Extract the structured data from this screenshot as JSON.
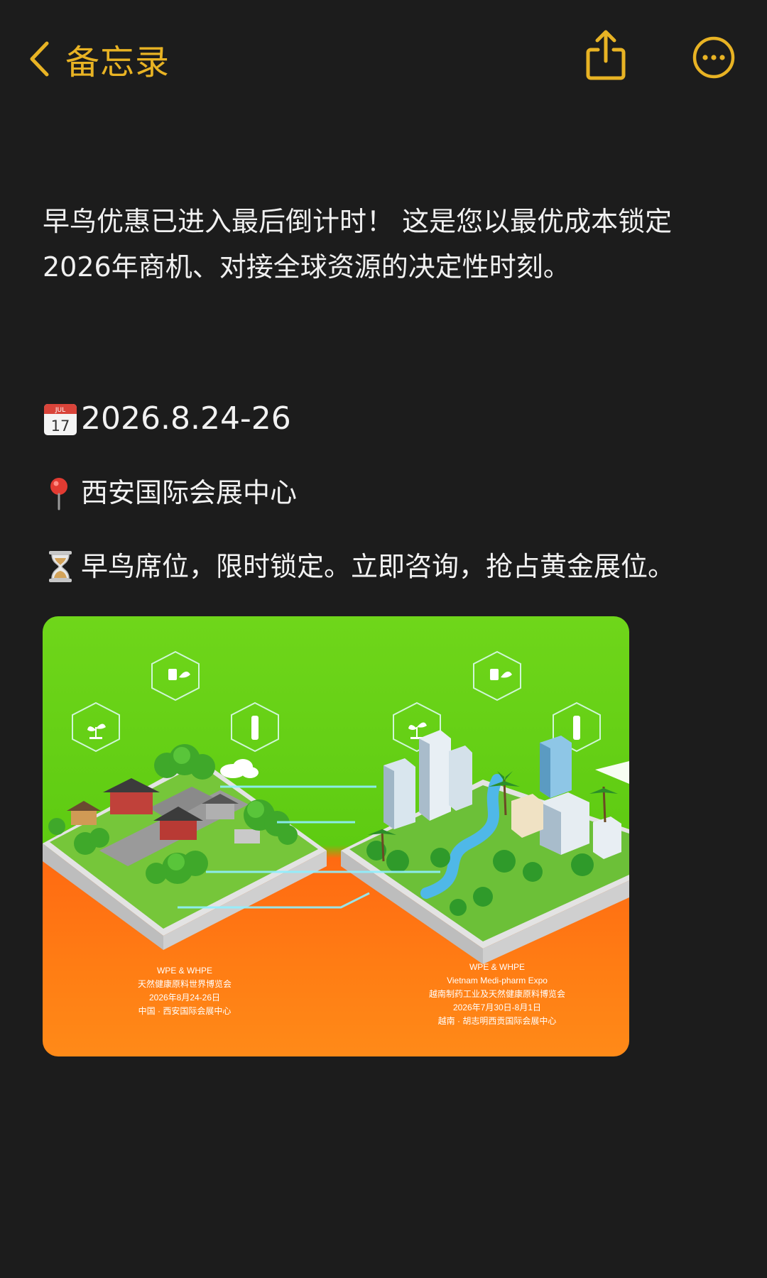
{
  "nav": {
    "back_label": "备忘录",
    "back_icon": "chevron-left-icon",
    "share_icon": "share-icon",
    "more_icon": "ellipsis-circle-icon",
    "accent_color": "#e8b324"
  },
  "note": {
    "intro_line1": "早鸟优惠已进入最后倒计时！ 这是您以最优成本锁定",
    "intro_line2": "2026年商机、对接全球资源的决定性时刻。",
    "date_icon": "calendar-icon",
    "date_icon_month": "JUL",
    "date_icon_day": "17",
    "date": "2026.8.24-26",
    "venue_icon": "round-pushpin-icon",
    "venue": "西安国际会展中心",
    "cta_icon": "hourglass-icon",
    "cta": "早鸟席位，限时锁定。立即咨询，抢占黄金展位。"
  },
  "poster": {
    "left_caption": [
      "WPE & WHPE",
      "天然健康原料世界博览会",
      "2026年8月24-26日",
      "中国 · 西安国际会展中心"
    ],
    "right_caption": [
      "WPE & WHPE",
      "Vietnam Medi-pharm Expo",
      "越南制药工业及天然健康原料博览会",
      "2026年7月30日-8月1日",
      "越南 · 胡志明西贡国际会展中心"
    ]
  }
}
